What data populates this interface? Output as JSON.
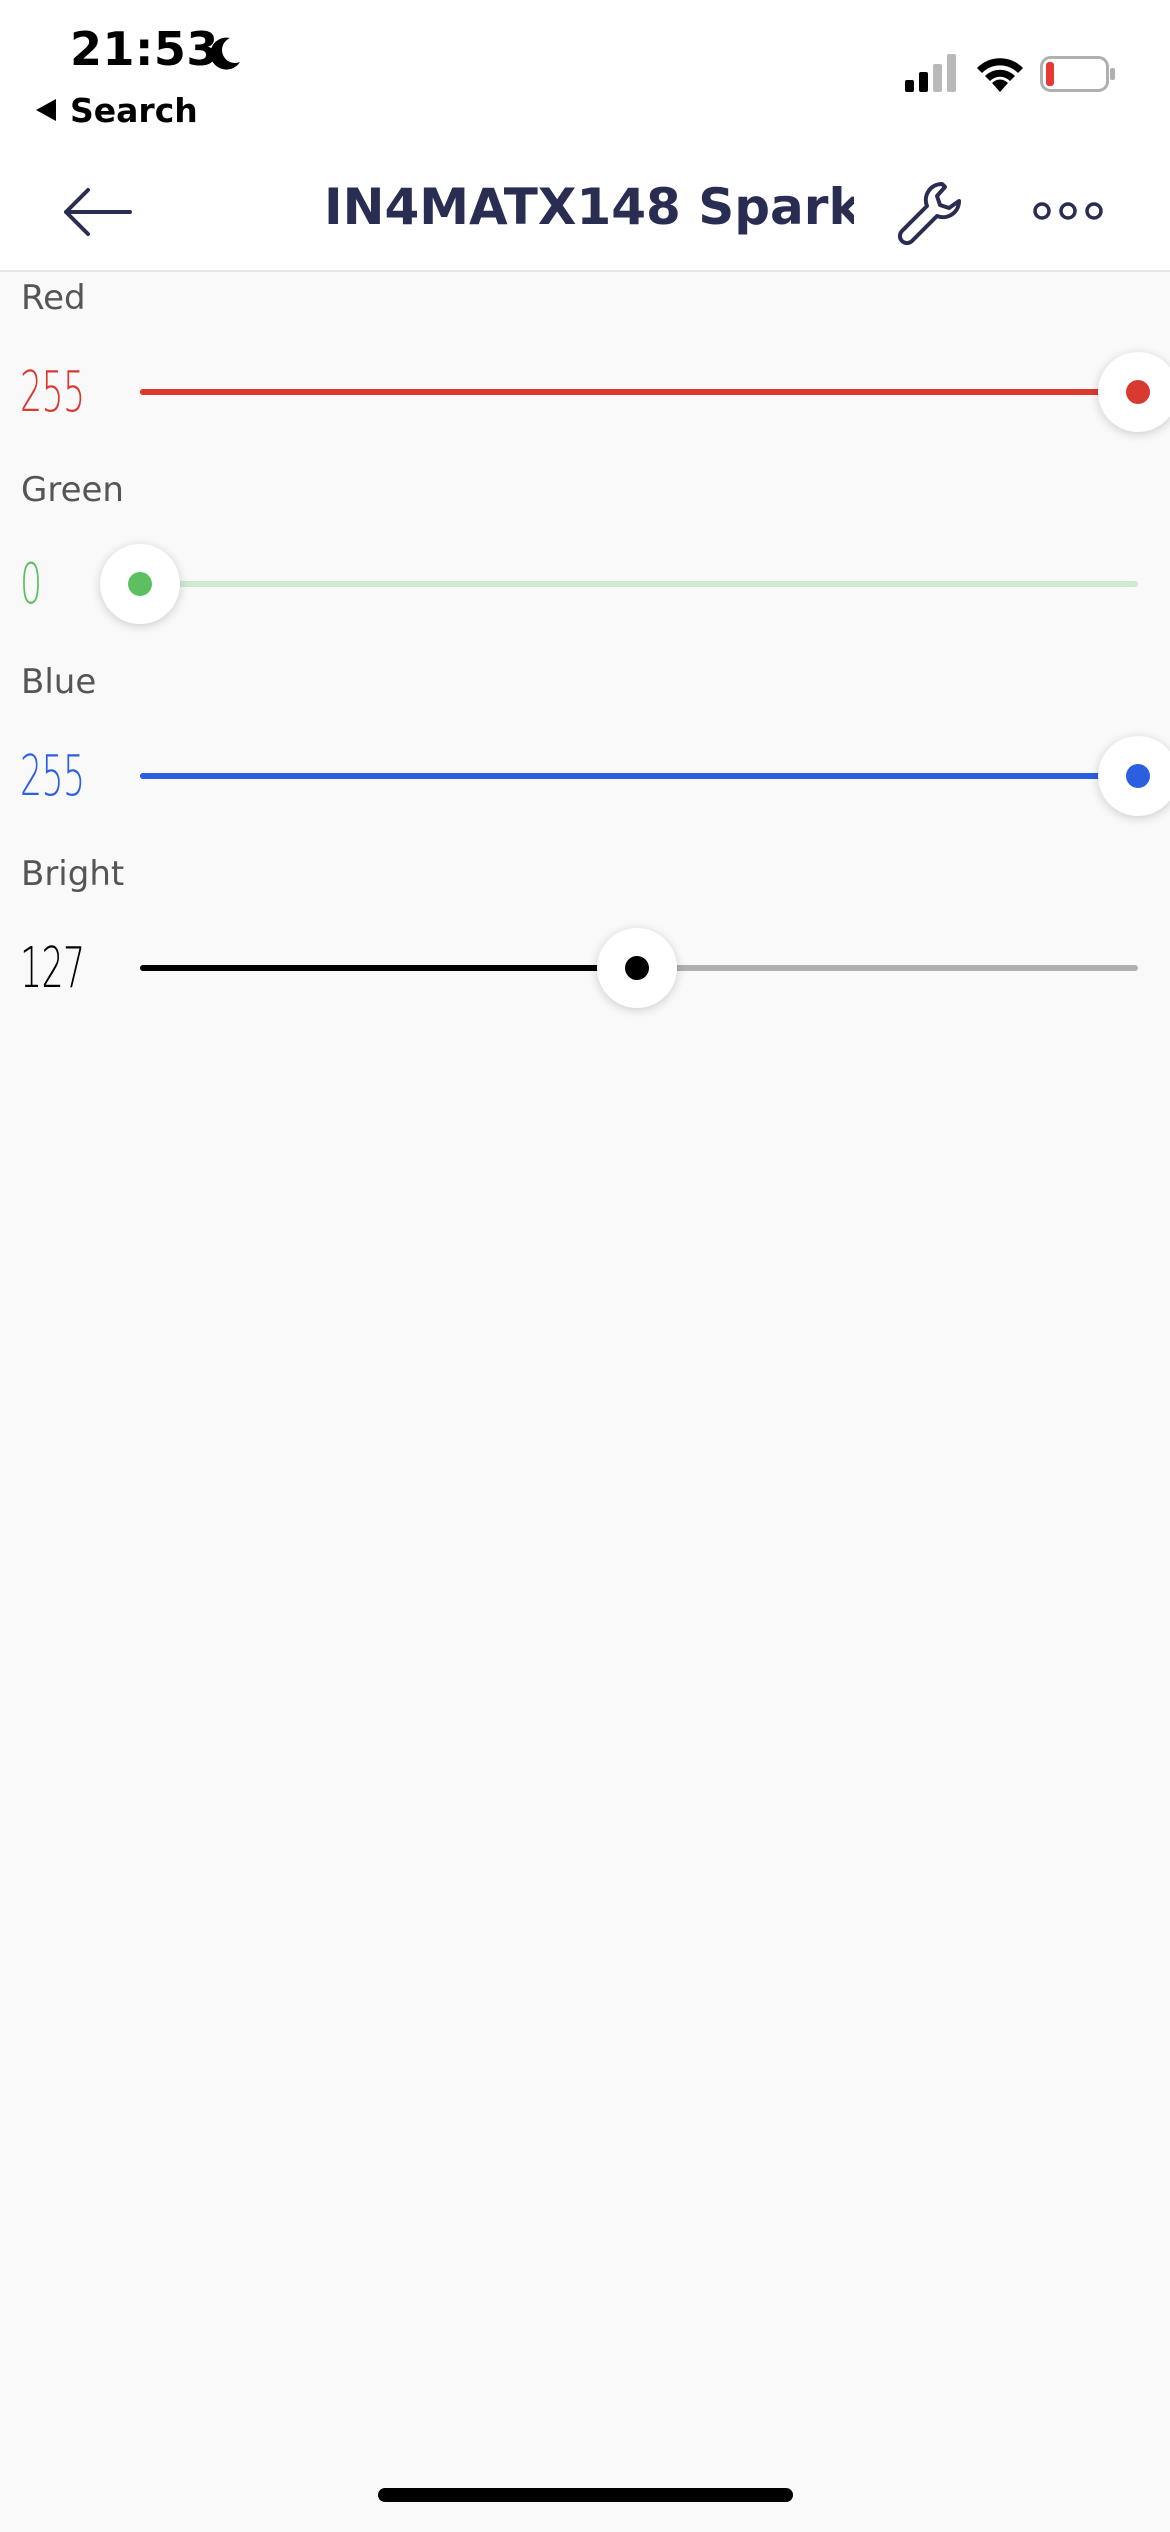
{
  "status_bar": {
    "time": "21:53",
    "back_app_label": "Search",
    "icons": [
      "moon-icon",
      "signal-icon",
      "wifi-icon",
      "battery-icon"
    ],
    "battery_color": "#e53935"
  },
  "nav": {
    "title": "IN4MATX148 Spark...",
    "icons": [
      "arrow-left-icon",
      "wrench-icon",
      "more-icon"
    ],
    "title_color": "#2a2d52"
  },
  "sliders": [
    {
      "label": "Red",
      "value": "255",
      "level": 1.0,
      "accent": "#d93a2f",
      "track": "#d93a2f"
    },
    {
      "label": "Green",
      "value": "0",
      "level": 0.0,
      "accent": "#5cbf60",
      "track": "#cfe9cf"
    },
    {
      "label": "Blue",
      "value": "255",
      "level": 1.0,
      "accent": "#2c5fe0",
      "track": "#2c5fe0"
    },
    {
      "label": "Bright",
      "value": "127",
      "level": 0.498,
      "accent": "#000000",
      "track": "#b0b0b0"
    }
  ]
}
